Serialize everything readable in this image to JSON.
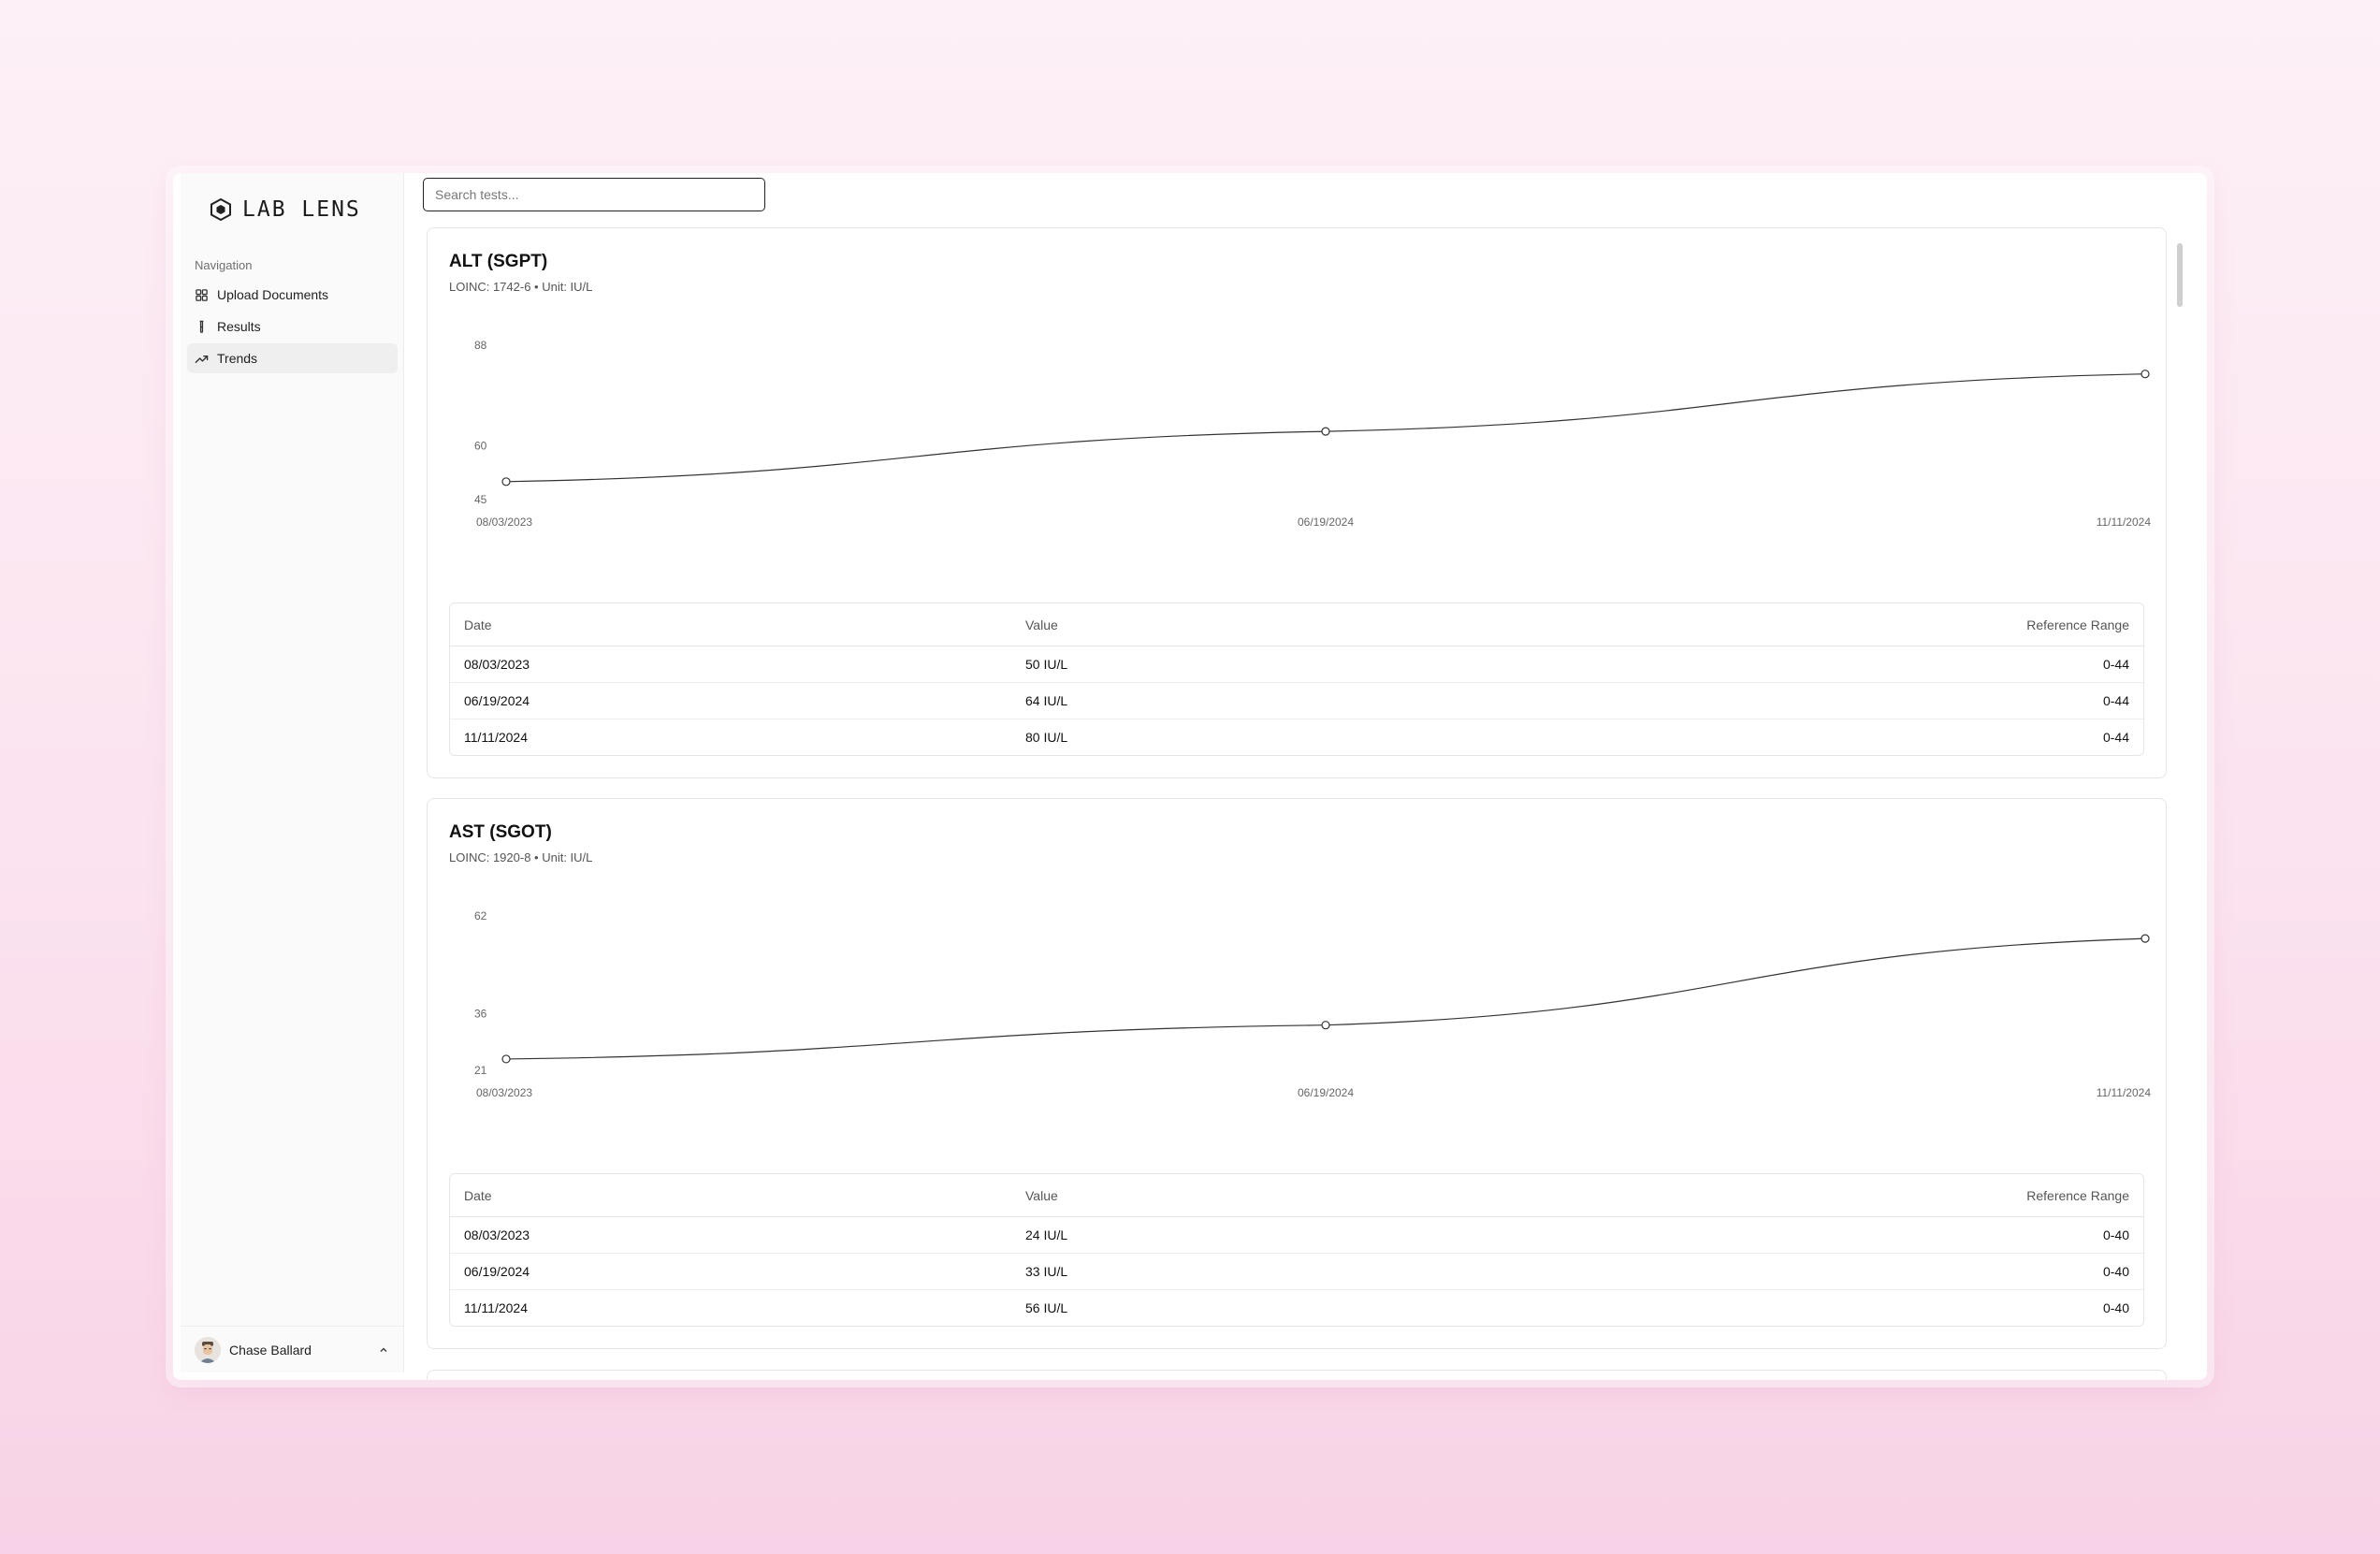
{
  "app": {
    "brand": "LAB LENS"
  },
  "sidebar": {
    "group_label": "Navigation",
    "items": [
      {
        "label": "Upload Documents",
        "icon": "grid-icon",
        "active": false
      },
      {
        "label": "Results",
        "icon": "test-tube-icon",
        "active": false
      },
      {
        "label": "Trends",
        "icon": "trending-up-icon",
        "active": true
      }
    ],
    "user": {
      "name": "Chase Ballard"
    }
  },
  "search": {
    "placeholder": "Search tests...",
    "value": ""
  },
  "cards": [
    {
      "title": "ALT (SGPT)",
      "subtitle": "LOINC: 1742-6 • Unit: IU/L",
      "table": {
        "headers": [
          "Date",
          "Value",
          "Reference Range"
        ],
        "rows": [
          [
            "08/03/2023",
            "50 IU/L",
            "0-44"
          ],
          [
            "06/19/2024",
            "64 IU/L",
            "0-44"
          ],
          [
            "11/11/2024",
            "80 IU/L",
            "0-44"
          ]
        ]
      }
    },
    {
      "title": "AST (SGOT)",
      "subtitle": "LOINC: 1920-8 • Unit: IU/L",
      "table": {
        "headers": [
          "Date",
          "Value",
          "Reference Range"
        ],
        "rows": [
          [
            "08/03/2023",
            "24 IU/L",
            "0-40"
          ],
          [
            "06/19/2024",
            "33 IU/L",
            "0-40"
          ],
          [
            "11/11/2024",
            "56 IU/L",
            "0-40"
          ]
        ]
      }
    }
  ],
  "chart_data": [
    {
      "type": "line",
      "title": "ALT (SGPT)",
      "x": [
        "08/03/2023",
        "06/19/2024",
        "11/11/2024"
      ],
      "series": [
        {
          "values": [
            50,
            64,
            80
          ]
        }
      ],
      "yticks": [
        45,
        60,
        88
      ],
      "ylim": [
        45,
        88
      ],
      "grid": false
    },
    {
      "type": "line",
      "title": "AST (SGOT)",
      "x": [
        "08/03/2023",
        "06/19/2024",
        "11/11/2024"
      ],
      "series": [
        {
          "values": [
            24,
            33,
            56
          ]
        }
      ],
      "yticks": [
        21,
        36,
        62
      ],
      "ylim": [
        21,
        62
      ],
      "grid": false
    }
  ]
}
